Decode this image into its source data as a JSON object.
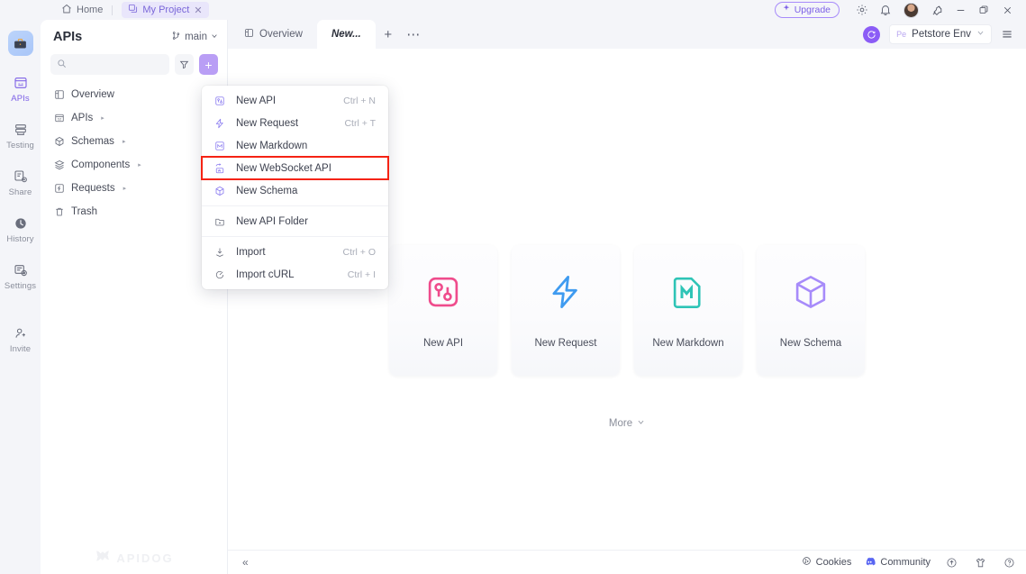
{
  "titlebar": {
    "home_label": "Home",
    "project_tab_label": "My Project",
    "project_tab_close": "✕",
    "upgrade_label": "Upgrade",
    "icons": {
      "home": "home-icon",
      "project": "project-icon",
      "settings": "gear-icon",
      "notifications": "bell-icon",
      "avatar": "user-avatar",
      "pin": "pin-icon",
      "minimize": "minimize-icon",
      "maximize": "maximize-icon",
      "close": "close-icon"
    }
  },
  "rail": {
    "logo": "briefcase-logo",
    "items": [
      {
        "label": "APIs",
        "icon": "apis-icon",
        "active": true
      },
      {
        "label": "Testing",
        "icon": "testing-icon",
        "active": false
      },
      {
        "label": "Share",
        "icon": "share-icon",
        "active": false
      },
      {
        "label": "History",
        "icon": "history-icon",
        "active": false
      },
      {
        "label": "Settings",
        "icon": "settings-icon",
        "active": false
      },
      {
        "label": "Invite",
        "icon": "invite-icon",
        "active": false
      }
    ]
  },
  "panel": {
    "title": "APIs",
    "branch_label": "main",
    "search_placeholder": "",
    "filter_icon": "filter-icon",
    "add_label": "+",
    "tree": [
      {
        "label": "Overview",
        "icon": "overview-icon",
        "caret": ""
      },
      {
        "label": "APIs",
        "icon": "apis-tree-icon",
        "caret": "▸"
      },
      {
        "label": "Schemas",
        "icon": "schemas-icon",
        "caret": "▸"
      },
      {
        "label": "Components",
        "icon": "components-icon",
        "caret": "▸"
      },
      {
        "label": "Requests",
        "icon": "requests-icon",
        "caret": "▸"
      },
      {
        "label": "Trash",
        "icon": "trash-icon",
        "caret": ""
      }
    ],
    "watermark": "APIDOG"
  },
  "tabbar": {
    "tabs": [
      {
        "label": "Overview",
        "icon": "overview-tab-icon",
        "active": false
      },
      {
        "label": "New...",
        "icon": "",
        "active": true
      }
    ],
    "new_tab": "+",
    "more_tabs": "⋯",
    "sync_icon": "sync-icon",
    "env_badge": "Pe",
    "env_label": "Petstore Env",
    "env_caret": "∨",
    "menu_icon": "hamburger-icon"
  },
  "menu": {
    "groups": [
      {
        "items": [
          {
            "label": "New API",
            "shortcut": "Ctrl + N",
            "icon": "new-api-icon",
            "highlighted": false
          },
          {
            "label": "New Request",
            "shortcut": "Ctrl + T",
            "icon": "new-request-icon",
            "highlighted": false
          },
          {
            "label": "New Markdown",
            "shortcut": "",
            "icon": "new-markdown-icon",
            "highlighted": false
          },
          {
            "label": "New WebSocket API",
            "shortcut": "",
            "icon": "new-websocket-icon",
            "highlighted": true
          },
          {
            "label": "New Schema",
            "shortcut": "",
            "icon": "new-schema-icon",
            "highlighted": false
          }
        ]
      },
      {
        "items": [
          {
            "label": "New API Folder",
            "shortcut": "",
            "icon": "new-folder-icon",
            "highlighted": false
          }
        ]
      },
      {
        "items": [
          {
            "label": "Import",
            "shortcut": "Ctrl + O",
            "icon": "import-icon",
            "highlighted": false
          },
          {
            "label": "Import cURL",
            "shortcut": "Ctrl + I",
            "icon": "import-curl-icon",
            "highlighted": false
          }
        ]
      }
    ]
  },
  "content": {
    "cards": [
      {
        "label": "New API",
        "icon": "new-api-card-icon",
        "color": "#ef4c8c"
      },
      {
        "label": "New Request",
        "icon": "new-request-card-icon",
        "color": "#3f9bf0"
      },
      {
        "label": "New Markdown",
        "icon": "new-markdown-card-icon",
        "color": "#2ec4b6"
      },
      {
        "label": "New Schema",
        "icon": "new-schema-card-icon",
        "color": "#a78bfa"
      }
    ],
    "more_label": "More",
    "more_caret": "∨"
  },
  "bottombar": {
    "collapse": "«",
    "cookies_label": "Cookies",
    "community_label": "Community",
    "icons": [
      "upgrade-circle-icon",
      "shirt-icon",
      "help-circle-icon"
    ]
  }
}
